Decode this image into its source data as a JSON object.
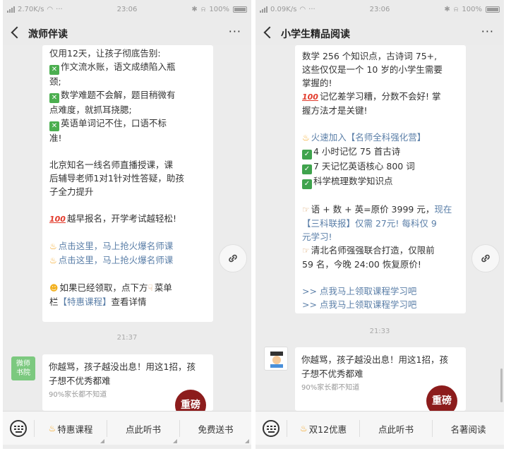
{
  "left": {
    "status": {
      "speed": "2.70K/s",
      "time": "23:06",
      "battery": "100%"
    },
    "title": "溦师伴读",
    "bubble_lines": [
      {
        "text": "仅用12天，让孩子彻底告别:"
      },
      {
        "icon": "x",
        "text": "作文流水账，语文成绩陷入瓶"
      },
      {
        "text": "颈;"
      },
      {
        "icon": "x",
        "text": "数学难题不会解，题目稍微有"
      },
      {
        "text": "点难度，就抓耳挠腮;"
      },
      {
        "icon": "x",
        "text": "英语单词记不住，口语不标"
      },
      {
        "text": "准!"
      },
      {
        "gap": true
      },
      {
        "text": "  北京知名一线名师直播授课，课"
      },
      {
        "text": "后辅导老师1对1针对性答疑，助孩"
      },
      {
        "text": "子全力提升"
      },
      {
        "gap": true
      },
      {
        "icon": "100",
        "text": "越早报名，开学考试越轻松!"
      },
      {
        "gap": true
      },
      {
        "icon": "fire",
        "text": "点击这里，马上抢火爆名师课",
        "link": true
      },
      {
        "icon": "fire",
        "text": "点击这里，马上抢火爆名师课",
        "link": true
      },
      {
        "gap": true
      },
      {
        "icon": "love",
        "text": "如果已经领取，点下方",
        "tail_icon": "point",
        "tail": "菜单"
      },
      {
        "text": "栏【特惠课程】查看详情",
        "partial_link": "【特惠课程】"
      }
    ],
    "timestamp": "21:37",
    "avatar_text": [
      "微师",
      "书院"
    ],
    "card": {
      "title": "你越骂，孩子越没出息！用这1招，孩子想不优秀都难",
      "subtitle": "90%家长都不知道",
      "badge": "重磅"
    },
    "menu": [
      "特惠课程",
      "点此听书",
      "免费送书"
    ]
  },
  "right": {
    "status": {
      "speed": "0.09K/s",
      "time": "23:06",
      "battery": "100%"
    },
    "title": "小学生精品阅读",
    "bubble_lines": [
      {
        "text": "数学 256 个知识点，古诗词 75+,"
      },
      {
        "text": "这些仅仅是一个 10 岁的小学生需要"
      },
      {
        "text": "掌握的!"
      },
      {
        "icon": "100",
        "text": "记忆差学习糟，分数不会好! 掌"
      },
      {
        "text": "握方法才是关键!"
      },
      {
        "gap": true
      },
      {
        "icon": "fire",
        "text": "火速加入【名师全科强化营】",
        "link": true
      },
      {
        "icon": "ok",
        "text": "4 小时记忆 75 首古诗"
      },
      {
        "icon": "ok",
        "text": "7 天记忆英语核心 800 词"
      },
      {
        "icon": "ok",
        "text": "科学梳理数学知识点"
      },
      {
        "gap": true
      },
      {
        "icon": "hand",
        "text": "语 + 数 + 英=原价 3999 元，",
        "tail": "现在",
        "tail_link": true
      },
      {
        "text": "【三科联报】仅需 27元! 每科仅 9",
        "link": true
      },
      {
        "text": "元学习!",
        "link": true
      },
      {
        "icon": "hand",
        "text": "清北名师强强联合打造，仅限前"
      },
      {
        "text": "59 名，今晚 24:00 恢复原价!"
      },
      {
        "gap": true
      },
      {
        "text": ">> 点我马上领取课程学习吧",
        "link": true
      },
      {
        "text": ">> 点我马上领取课程学习吧",
        "link": true
      }
    ],
    "timestamp": "21:33",
    "card": {
      "title": "你越骂，孩子越没出息！用这1招，孩子想不优秀都难",
      "subtitle": "90%家长都不知道",
      "badge": "重磅"
    },
    "menu": [
      "双12优惠",
      "点此听书",
      "名著阅读"
    ]
  },
  "colors": {
    "link": "#5b7fa8",
    "badge": "#8c1c1c",
    "checkbox": "#4caf50",
    "avatar": "#7cc97f"
  },
  "icons": [
    "back-icon",
    "more-icon",
    "link-icon",
    "keyboard-icon",
    "fire-icon",
    "check-icon",
    "cross-icon"
  ]
}
